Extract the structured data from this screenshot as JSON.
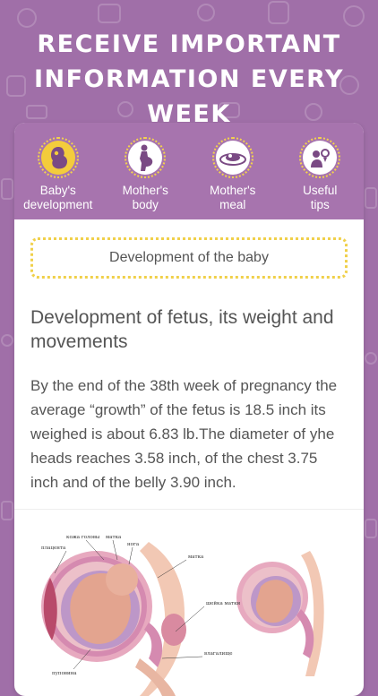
{
  "headline": "RECEIVE IMPORTANT INFORMATION EVERY WEEK",
  "tabs": [
    {
      "label": "Baby's\ndevelopment",
      "icon": "baby-icon",
      "active": true
    },
    {
      "label": "Mother's\nbody",
      "icon": "pregnant-mother-icon",
      "active": false
    },
    {
      "label": "Mother's\nmeal",
      "icon": "meal-plate-icon",
      "active": false
    },
    {
      "label": "Useful\ntips",
      "icon": "tips-icon",
      "active": false
    }
  ],
  "section_title": "Development of the baby",
  "article": {
    "title": "Development of fetus, its weight and movements",
    "body": "By the end of the 38th week of pregnancy the average “growth” of the fetus is 18.5 inch its weighed is about 6.83 lb.The diameter of yhe heads reaches 3.58 inch, of the chest 3.75 inch and of the belly 3.90 inch."
  },
  "illustration_labels": {
    "l1": "кожа головы",
    "l2": "матка",
    "l3": "нога",
    "l4": "плацента",
    "l5": "матка",
    "l6": "шейка матки",
    "l7": "пуповина",
    "l8": "влагалище"
  },
  "colors": {
    "background": "#a06fa8",
    "tabbar": "#a774ae",
    "accent": "#f3cc3c"
  }
}
